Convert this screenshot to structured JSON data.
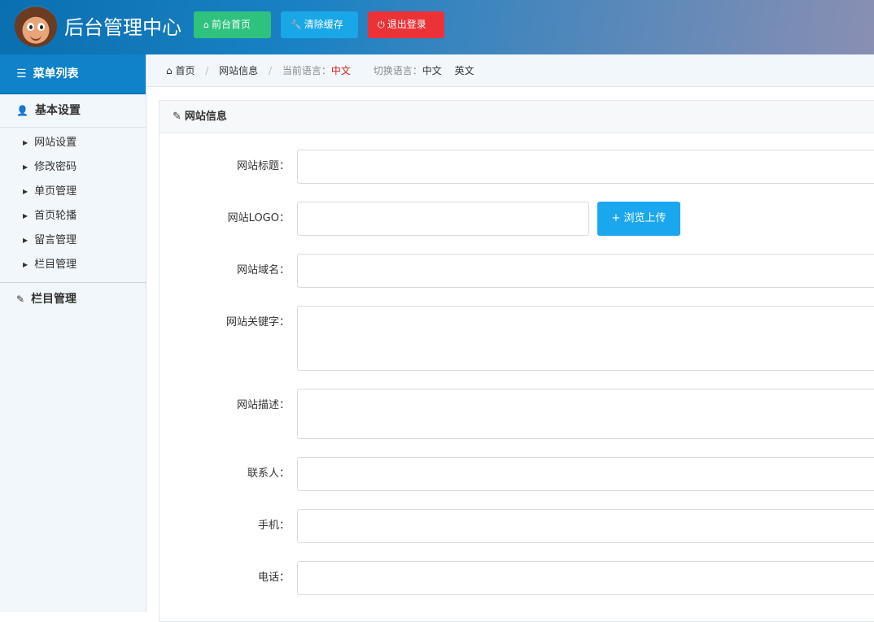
{
  "header": {
    "title": "后台管理中心",
    "buttons": {
      "home": "前台首页",
      "clear_cache": "清除缓存",
      "logout": "退出登录"
    }
  },
  "sidebar": {
    "menu_title": "菜单列表",
    "groups": [
      {
        "label": "基本设置",
        "items": [
          "网站设置",
          "修改密码",
          "单页管理",
          "首页轮播",
          "留言管理",
          "栏目管理"
        ]
      },
      {
        "label": "栏目管理",
        "items": []
      }
    ]
  },
  "breadcrumb": {
    "home": "首页",
    "page": "网站信息",
    "current_lang_label": "当前语言：",
    "current_lang": "中文",
    "switch_label": "切换语言：",
    "lang_zh": "中文",
    "lang_en": "英文"
  },
  "panel": {
    "title": "网站信息",
    "upload_button": "+ 浏览上传",
    "fields": {
      "site_title": "网站标题：",
      "logo": "网站LOGO：",
      "domain": "网站域名：",
      "keywords": "网站关键字：",
      "description": "网站描述：",
      "contact": "联系人：",
      "mobile": "手机：",
      "phone": "电话："
    }
  },
  "colors": {
    "green": "#2ec27e",
    "blue": "#19a7e8",
    "red": "#ec3237",
    "sidebar_head": "#0f82c9"
  }
}
